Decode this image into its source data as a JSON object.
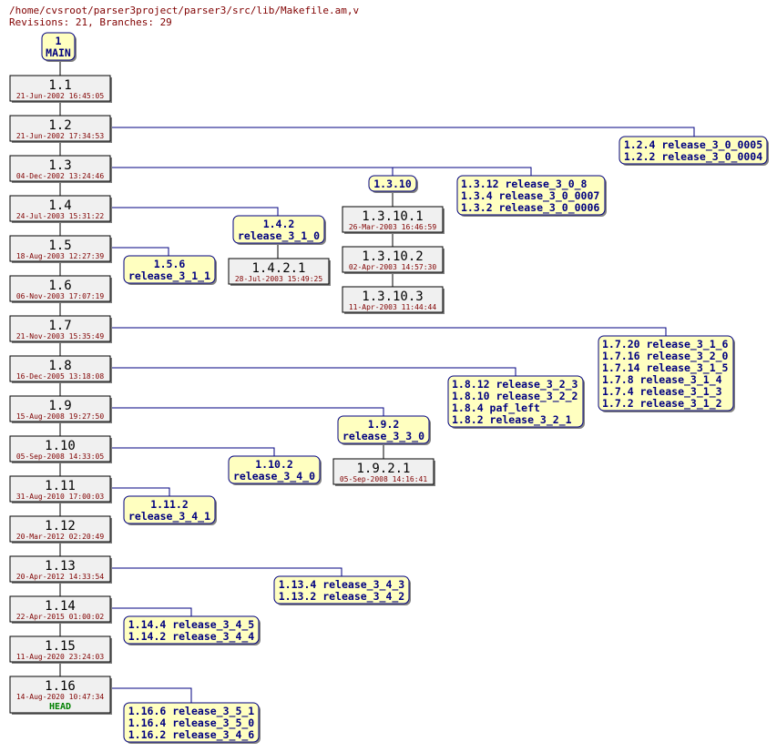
{
  "header": {
    "path": "/home/cvsroot/parser3project/parser3/src/lib/Makefile.am,v",
    "summary": "Revisions: 21, Branches: 29"
  },
  "colors": {
    "rev_fill": "#f0f0f0",
    "tag_fill": "#ffffc0",
    "tag_text": "#000080",
    "date_text": "#800000",
    "head_text": "#008000",
    "edge": "#000080"
  },
  "main_branch": {
    "number": "1",
    "name": "MAIN"
  },
  "trunk": [
    {
      "rev": "1.1",
      "date": "21-Jun-2002 16:45:05"
    },
    {
      "rev": "1.2",
      "date": "21-Jun-2002 17:34:53"
    },
    {
      "rev": "1.3",
      "date": "04-Dec-2002 13:24:46"
    },
    {
      "rev": "1.4",
      "date": "24-Jul-2003 15:31:22"
    },
    {
      "rev": "1.5",
      "date": "18-Aug-2003 12:27:39"
    },
    {
      "rev": "1.6",
      "date": "06-Nov-2003 17:07:19"
    },
    {
      "rev": "1.7",
      "date": "21-Nov-2003 15:35:49"
    },
    {
      "rev": "1.8",
      "date": "16-Dec-2005 13:18:08"
    },
    {
      "rev": "1.9",
      "date": "15-Aug-2008 19:27:50"
    },
    {
      "rev": "1.10",
      "date": "05-Sep-2008 14:33:05"
    },
    {
      "rev": "1.11",
      "date": "31-Aug-2010 17:00:03"
    },
    {
      "rev": "1.12",
      "date": "20-Mar-2012 02:20:49"
    },
    {
      "rev": "1.13",
      "date": "20-Apr-2012 14:33:54"
    },
    {
      "rev": "1.14",
      "date": "22-Apr-2015 01:00:02"
    },
    {
      "rev": "1.15",
      "date": "11-Aug-2020 23:24:03"
    },
    {
      "rev": "1.16",
      "date": "14-Aug-2020 10:47:34",
      "head": "HEAD"
    }
  ],
  "tag_boxes": [
    {
      "id": "t12",
      "lines": [
        "1.2.4 release_3_0_0005",
        "1.2.2 release_3_0_0004"
      ]
    },
    {
      "id": "t1310",
      "lines": [
        "1.3.10"
      ]
    },
    {
      "id": "t13",
      "lines": [
        "1.3.12 release_3_0_8",
        " 1.3.4 release_3_0_0007",
        " 1.3.2 release_3_0_0006"
      ]
    },
    {
      "id": "t14",
      "lines": [
        "1.4.2",
        "release_3_1_0"
      ]
    },
    {
      "id": "t15",
      "lines": [
        "1.5.6",
        "release_3_1_1"
      ]
    },
    {
      "id": "t17",
      "lines": [
        "1.7.20 release_3_1_6",
        "1.7.16 release_3_2_0",
        "1.7.14 release_3_1_5",
        " 1.7.8 release_3_1_4",
        " 1.7.4 release_3_1_3",
        " 1.7.2 release_3_1_2"
      ]
    },
    {
      "id": "t18",
      "lines": [
        "1.8.12 release_3_2_3",
        "1.8.10 release_3_2_2",
        " 1.8.4 paf_left",
        " 1.8.2 release_3_2_1"
      ]
    },
    {
      "id": "t19",
      "lines": [
        "1.9.2",
        "release_3_3_0"
      ]
    },
    {
      "id": "t110",
      "lines": [
        "1.10.2",
        "release_3_4_0"
      ]
    },
    {
      "id": "t111",
      "lines": [
        "1.11.2",
        "release_3_4_1"
      ]
    },
    {
      "id": "t113",
      "lines": [
        "1.13.4 release_3_4_3",
        "1.13.2 release_3_4_2"
      ]
    },
    {
      "id": "t114",
      "lines": [
        "1.14.4 release_3_4_5",
        "1.14.2 release_3_4_4"
      ]
    },
    {
      "id": "t116",
      "lines": [
        "1.16.6 release_3_5_1",
        "1.16.4 release_3_5_0",
        "1.16.2 release_3_4_6"
      ]
    }
  ],
  "branch_revisions": [
    {
      "id": "b1310_1",
      "rev": "1.3.10.1",
      "date": "26-Mar-2003 16:46:59"
    },
    {
      "id": "b1310_2",
      "rev": "1.3.10.2",
      "date": "02-Apr-2003 14:57:30"
    },
    {
      "id": "b1310_3",
      "rev": "1.3.10.3",
      "date": "11-Apr-2003 11:44:44"
    },
    {
      "id": "b142_1",
      "rev": "1.4.2.1",
      "date": "28-Jul-2003 15:49:25"
    },
    {
      "id": "b192_1",
      "rev": "1.9.2.1",
      "date": "05-Sep-2008 14:16:41"
    }
  ]
}
